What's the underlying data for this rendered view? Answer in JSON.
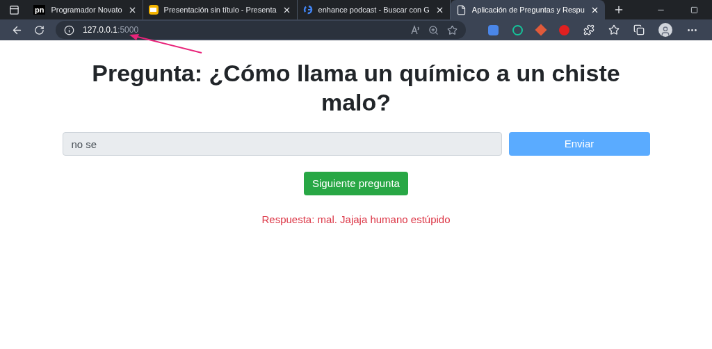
{
  "browser": {
    "tabs": [
      {
        "title": "Programador Novato",
        "logo": "pn",
        "selected": false
      },
      {
        "title": "Presentación sin título - Presenta",
        "selected": false
      },
      {
        "title": "enhance podcast - Buscar con G",
        "selected": false
      },
      {
        "title": "Aplicación de Preguntas y Respu",
        "selected": true
      }
    ],
    "address": {
      "host": "127.0.0.1",
      "port": ":5000"
    }
  },
  "page": {
    "question": "Pregunta: ¿Cómo llama un químico a un chiste malo?",
    "answer_field": {
      "value": "no se"
    },
    "send_button": "Enviar",
    "next_button": "Siguiente pregunta",
    "response": "Respuesta: mal. Jajaja humano estúpido"
  }
}
